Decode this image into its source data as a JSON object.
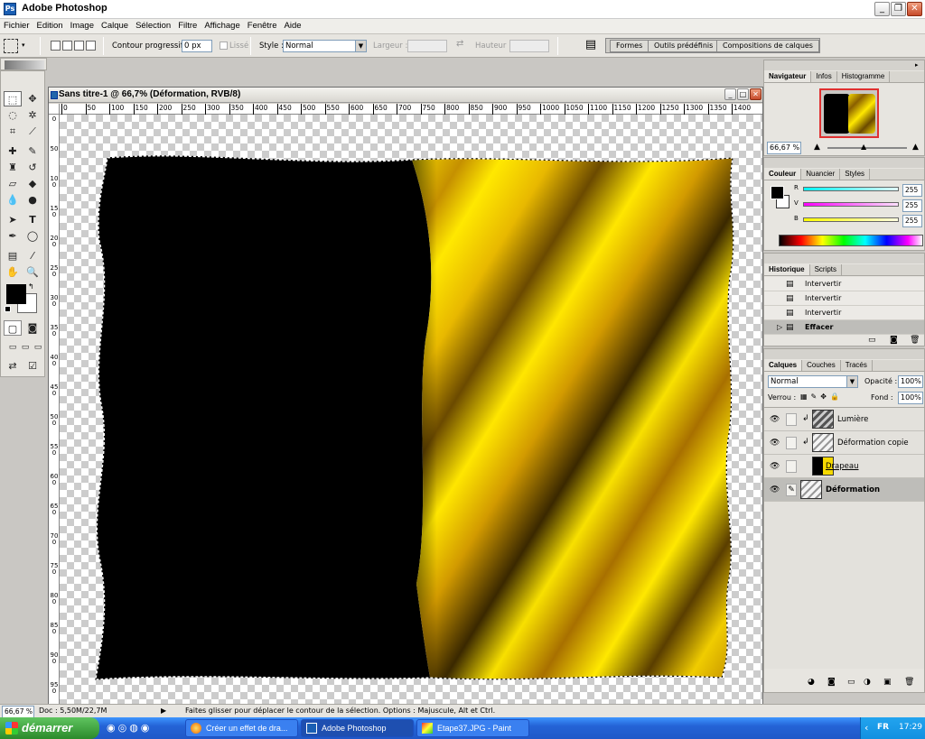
{
  "window": {
    "title": "Adobe Photoshop",
    "min_label": "_",
    "max_label": "❐",
    "close_label": "✕"
  },
  "menu": [
    "Fichier",
    "Edition",
    "Image",
    "Calque",
    "Sélection",
    "Filtre",
    "Affichage",
    "Fenêtre",
    "Aide"
  ],
  "options": {
    "feather_label": "Contour progressif :",
    "feather_value": "0 px",
    "antialias_label": "Lissé",
    "style_label": "Style :",
    "style_value": "Normal",
    "width_label": "Largeur :",
    "height_label": "Hauteur :",
    "wells": [
      "Formes",
      "Outils prédéfinis",
      "Compositions de calques"
    ]
  },
  "document": {
    "title": "Sans titre-1 @ 66,7% (Déformation, RVB/8)",
    "ruler_h": [
      "0",
      "50",
      "100",
      "150",
      "200",
      "250",
      "300",
      "350",
      "400",
      "450",
      "500",
      "550",
      "600",
      "650",
      "700",
      "750",
      "800",
      "850",
      "900",
      "950",
      "1000",
      "1050",
      "1100",
      "1150",
      "1200",
      "1250",
      "1300",
      "1350",
      "1400"
    ],
    "ruler_v": [
      "0",
      "50",
      "100",
      "150",
      "200",
      "250",
      "300",
      "350",
      "400",
      "450",
      "500",
      "550",
      "600",
      "650",
      "700",
      "750",
      "800",
      "850",
      "900",
      "950"
    ]
  },
  "navigator": {
    "tabs": [
      "Navigateur",
      "Infos",
      "Histogramme"
    ],
    "zoom": "66,67 %"
  },
  "color": {
    "tabs": [
      "Couleur",
      "Nuancier",
      "Styles"
    ],
    "channels": [
      {
        "label": "R",
        "value": "255",
        "color": "#30d8d8"
      },
      {
        "label": "V",
        "value": "255",
        "color": "#d830d8"
      },
      {
        "label": "B",
        "value": "255",
        "color": "#d8d830"
      }
    ]
  },
  "history": {
    "tabs": [
      "Historique",
      "Scripts"
    ],
    "items": [
      "Intervertir",
      "Intervertir",
      "Intervertir",
      "Effacer"
    ]
  },
  "layers": {
    "tabs": [
      "Calques",
      "Couches",
      "Tracés"
    ],
    "blend_mode": "Normal",
    "opacity_label": "Opacité :",
    "opacity_value": "100%",
    "lock_label": "Verrou :",
    "fill_label": "Fond :",
    "fill_value": "100%",
    "items": [
      {
        "name": "Lumière",
        "thumb": "pattern-dark"
      },
      {
        "name": "Déformation copie",
        "thumb": "pattern-light"
      },
      {
        "name": "Drapeau",
        "thumb": "flag"
      },
      {
        "name": "Déformation",
        "thumb": "pattern-light"
      }
    ]
  },
  "status": {
    "zoom": "66,67 %",
    "doc": "Doc : 5,50M/22,7M",
    "hint": "Faites glisser pour déplacer le contour de la sélection. Options : Majuscule, Alt et Ctrl."
  },
  "taskbar": {
    "start": "démarrer",
    "tasks": [
      "Créer un effet de dra...",
      "Adobe Photoshop",
      "Etape37.JPG - Paint"
    ],
    "clock": "17:29",
    "lang": "FR"
  },
  "colors": {
    "flag_black": "#000000",
    "flag_yellow": "#f2d200",
    "accent": "#2463d6"
  }
}
